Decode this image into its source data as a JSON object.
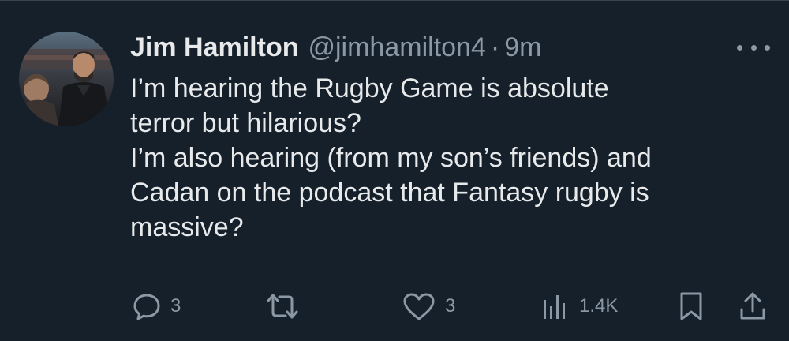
{
  "tweet": {
    "author_name": "Jim Hamilton",
    "handle": "@jimhamilton4",
    "separator": "·",
    "time": "9m",
    "lines": [
      "I’m hearing the Rugby Game is absolute",
      "terror but hilarious?",
      "I’m also hearing (from my son’s friends) and",
      "Cadan on the podcast that Fantasy rugby is",
      "massive?"
    ]
  },
  "actions": {
    "reply": {
      "icon": "reply-icon",
      "count": "3"
    },
    "retweet": {
      "icon": "retweet-icon",
      "count": ""
    },
    "like": {
      "icon": "heart-icon",
      "count": "3"
    },
    "views": {
      "icon": "views-icon",
      "count": "1.4K"
    },
    "bookmark": {
      "icon": "bookmark-icon"
    },
    "share": {
      "icon": "share-icon"
    }
  },
  "colors": {
    "background": "#15202b",
    "text": "#e7e9ea",
    "muted": "#8b98a5"
  }
}
